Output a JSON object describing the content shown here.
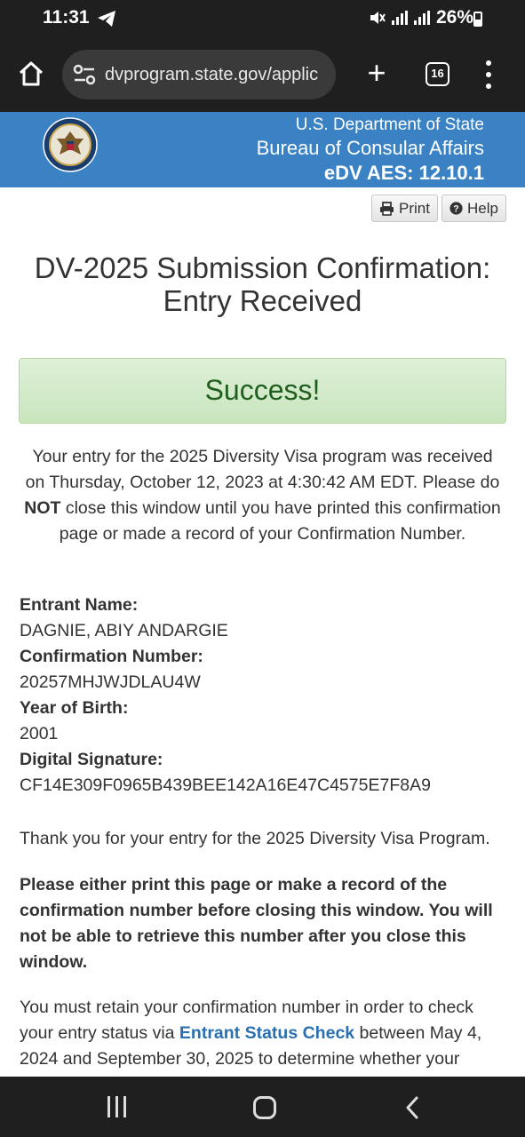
{
  "status_bar": {
    "time": "11:31",
    "battery": "26%"
  },
  "browser": {
    "url": "dvprogram.state.gov/applic",
    "tab_count": "16"
  },
  "header": {
    "line1": "U.S. Department of State",
    "line2": "Bureau of Consular Affairs",
    "line3": "eDV AES: 12.10.1"
  },
  "toolbar": {
    "print_label": "Print",
    "help_label": "Help"
  },
  "page": {
    "title_line1": "DV-2025 Submission Confirmation:",
    "title_line2": "Entry Received",
    "success": "Success!",
    "intro_part1": "Your entry for the 2025 Diversity Visa program was received on Thursday, October 12, 2023 at 4:30:42 AM EDT. Please do ",
    "intro_bold": "NOT",
    "intro_part2": " close this window until you have printed this confirmation page or made a record of your Confirmation Number.",
    "fields": [
      {
        "label": "Entrant Name:",
        "value": "DAGNIE, ABIY ANDARGIE"
      },
      {
        "label": "Confirmation Number:",
        "value": "20257MHJWJDLAU4W"
      },
      {
        "label": "Year of Birth:",
        "value": "2001"
      },
      {
        "label": "Digital Signature:",
        "value": "CF14E309F0965B439BEE142A16E47C4575E7F8A9"
      }
    ],
    "thanks": "Thank you for your entry for the 2025 Diversity Visa Program.",
    "warning": "Please either print this page or make a record of the confirmation number before closing this window. You will not be able to retrieve this number after you close this window.",
    "retain_part1": "You must retain your confirmation number in order to check your entry status via ",
    "retain_link": "Entrant Status Check",
    "retain_part2": " between May 4, 2024 and September 30, 2025 to determine whether your"
  },
  "icons": {
    "telegram": "telegram-icon",
    "mute": "mute-icon",
    "home": "home-icon",
    "site_settings": "tune-icon",
    "new_tab": "plus-icon",
    "more": "more-vert-icon",
    "print": "printer-icon",
    "help": "question-circle-icon"
  },
  "colors": {
    "header_blue": "#3a82c4",
    "success_green": "#1f5f1f",
    "link_blue": "#2a6fb0"
  }
}
